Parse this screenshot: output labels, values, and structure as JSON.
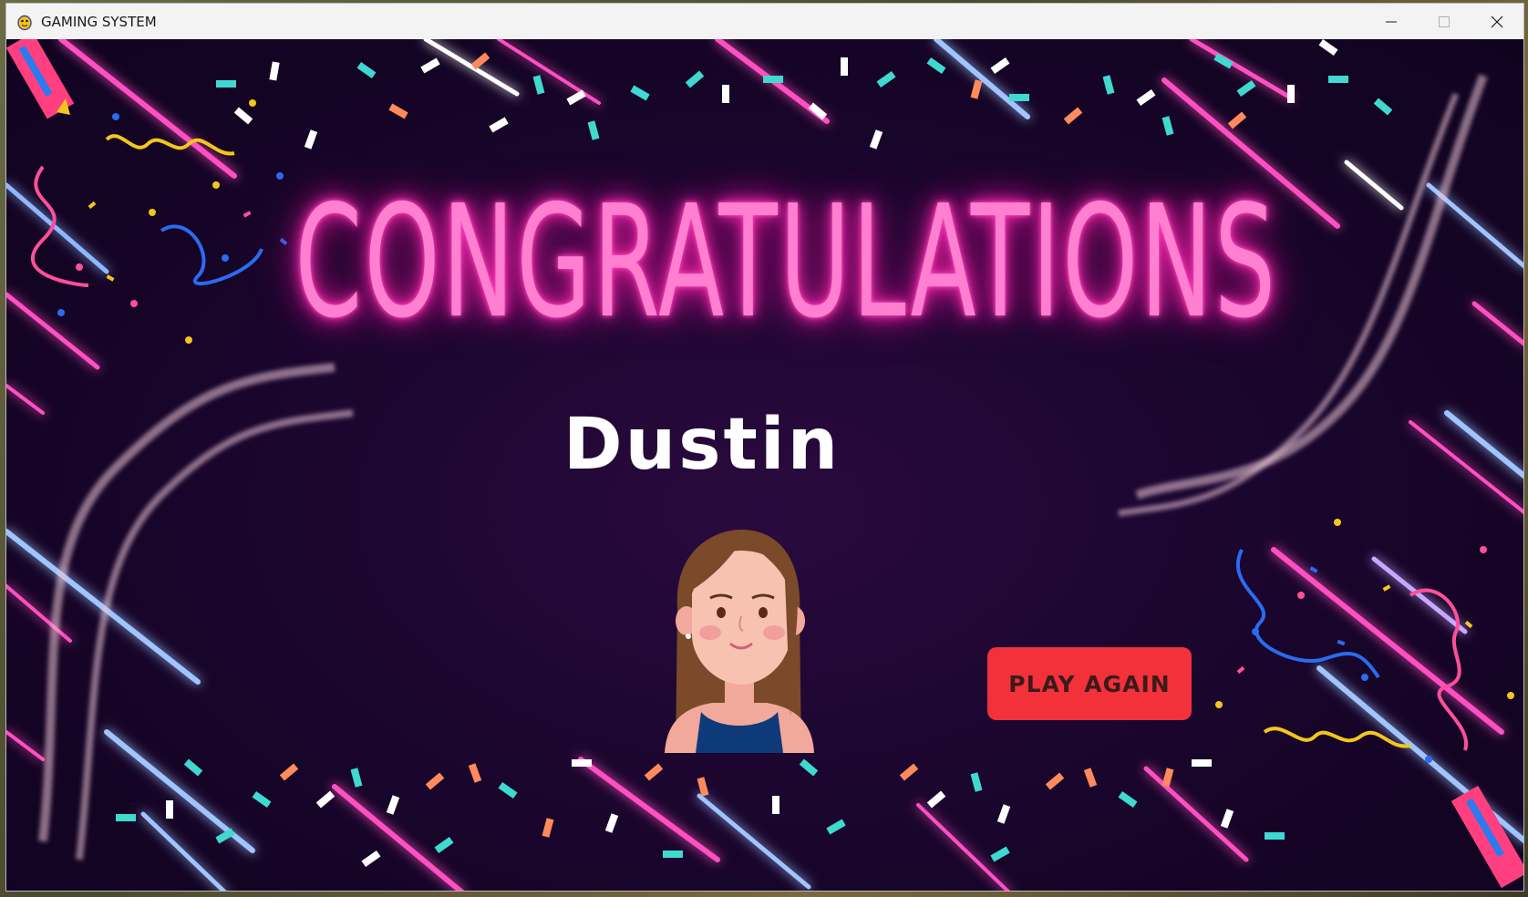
{
  "window": {
    "title": "GAMING SYSTEM",
    "icon": "pygame-snake-icon",
    "controls": [
      "minimize-icon",
      "maximize-icon",
      "close-icon"
    ]
  },
  "screen": {
    "headline": "CONGRATULATIONS",
    "player_name": "Dustin",
    "avatar": "girl-avatar",
    "play_again_label": "PLAY AGAIN"
  },
  "colors": {
    "background": "#1c0630",
    "headline": "#ff7fd0",
    "headline_glow": "#ff2fb0",
    "button": "#f2313a",
    "button_text": "#3b1a1a",
    "name": "#ffffff"
  }
}
